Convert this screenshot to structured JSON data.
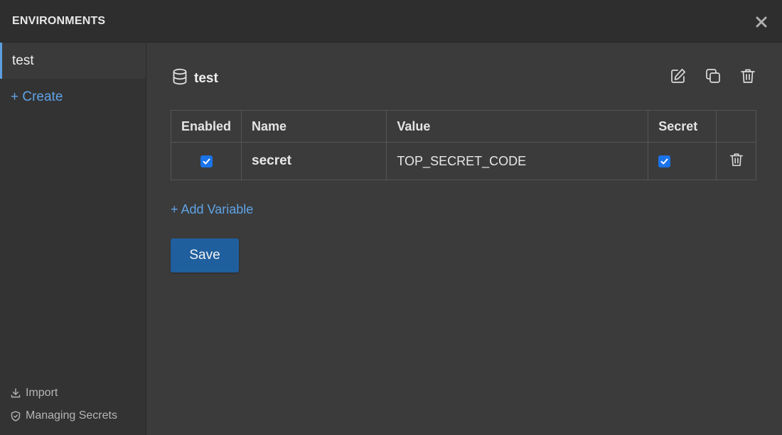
{
  "modal": {
    "title": "ENVIRONMENTS"
  },
  "sidebar": {
    "environments": [
      {
        "label": "test",
        "selected": true
      }
    ],
    "create_label": "+ Create",
    "footer": {
      "import_label": "Import",
      "managing_secrets_label": "Managing Secrets"
    }
  },
  "environment": {
    "name": "test",
    "icons": [
      "database-icon",
      "edit-icon",
      "copy-icon",
      "trash-icon"
    ]
  },
  "variables_table": {
    "columns": [
      "Enabled",
      "Name",
      "Value",
      "Secret"
    ],
    "rows": [
      {
        "enabled": true,
        "name": "secret",
        "value": "TOP_SECRET_CODE",
        "secret": true
      }
    ]
  },
  "actions": {
    "add_variable_label": "+ Add Variable",
    "save_label": "Save"
  },
  "colors": {
    "accent_link": "#5fa3e6",
    "selected_border": "#5d9fe0",
    "save_button": "#1f5f9e",
    "checkbox": "#1a73e8"
  }
}
